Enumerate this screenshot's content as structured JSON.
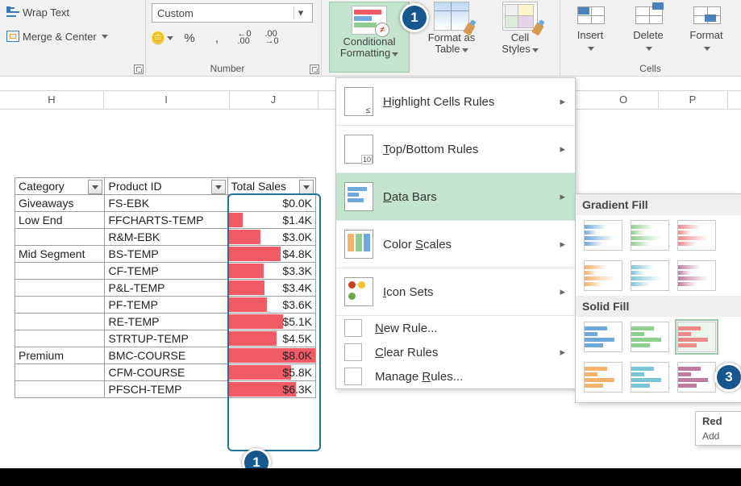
{
  "ribbon": {
    "alignment": {
      "wrap": "Wrap Text",
      "merge": "Merge & Center",
      "group": ""
    },
    "number": {
      "format": "Custom",
      "group": "Number",
      "pct": "%",
      "comma": ",",
      "incdec": "←0\n.00",
      "decdec": ".00\n→0"
    },
    "styles": {
      "cf": "Conditional\nFormatting",
      "ft": "Format as\nTable",
      "cs": "Cell\nStyles",
      "group": ""
    },
    "cells": {
      "insert": "Insert",
      "delete": "Delete",
      "format": "Format",
      "group": "Cells"
    }
  },
  "columns": {
    "H": "H",
    "I": "I",
    "J": "J",
    "O": "O",
    "P": "P"
  },
  "table": {
    "headers": {
      "cat": "Category",
      "pid": "Product ID",
      "sales": "Total Sales"
    },
    "rows": [
      {
        "cat": "Giveaways",
        "pid": "FS-EBK",
        "sales": "$0.0K",
        "pct": 0
      },
      {
        "cat": "Low End",
        "pid": "FFCHARTS-TEMP",
        "sales": "$1.4K",
        "pct": 17
      },
      {
        "cat": "",
        "pid": "R&M-EBK",
        "sales": "$3.0K",
        "pct": 37
      },
      {
        "cat": "Mid Segment",
        "pid": "BS-TEMP",
        "sales": "$4.8K",
        "pct": 60
      },
      {
        "cat": "",
        "pid": "CF-TEMP",
        "sales": "$3.3K",
        "pct": 41
      },
      {
        "cat": "",
        "pid": "P&L-TEMP",
        "sales": "$3.4K",
        "pct": 42
      },
      {
        "cat": "",
        "pid": "PF-TEMP",
        "sales": "$3.6K",
        "pct": 45
      },
      {
        "cat": "",
        "pid": "RE-TEMP",
        "sales": "$5.1K",
        "pct": 63
      },
      {
        "cat": "",
        "pid": "STRTUP-TEMP",
        "sales": "$4.5K",
        "pct": 56
      },
      {
        "cat": "Premium",
        "pid": "BMC-COURSE",
        "sales": "$8.0K",
        "pct": 100
      },
      {
        "cat": "",
        "pid": "CFM-COURSE",
        "sales": "$5.8K",
        "pct": 72
      },
      {
        "cat": "",
        "pid": "PFSCH-TEMP",
        "sales": "$6.3K",
        "pct": 78
      }
    ]
  },
  "menu": {
    "hcr": "Highlight Cells Rules",
    "tbr": "Top/Bottom Rules",
    "db": "Data Bars",
    "cs": "Color Scales",
    "is": "Icon Sets",
    "new": "New Rule...",
    "clr": "Clear Rules",
    "mng": "Manage Rules..."
  },
  "submenu": {
    "grad": "Gradient Fill",
    "solid": "Solid Fill"
  },
  "tooltip": {
    "title": "Red",
    "body": "Add"
  },
  "badges": {
    "b1": "1",
    "b1b": "1",
    "b3": "3"
  }
}
